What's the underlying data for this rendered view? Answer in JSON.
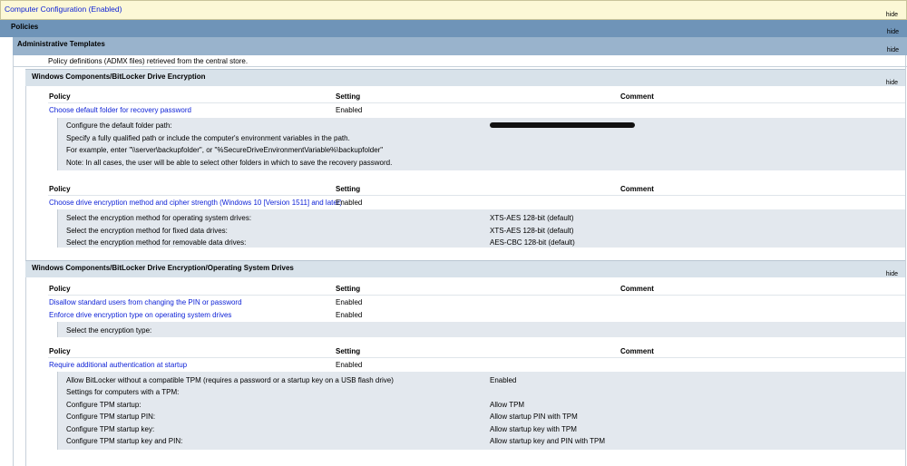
{
  "hide_label": "hide",
  "computer_config": {
    "title": "Computer Configuration (Enabled)"
  },
  "policies": {
    "title": "Policies"
  },
  "admin_templates": {
    "title": "Administrative Templates",
    "note": "Policy definitions (ADMX files) retrieved from the central store."
  },
  "table_headers": {
    "policy": "Policy",
    "setting": "Setting",
    "comment": "Comment"
  },
  "sections": [
    {
      "title": "Windows Components/BitLocker Drive Encryption",
      "groups": [
        {
          "policies": [
            {
              "name": "Choose default folder for recovery password",
              "setting": "Enabled"
            }
          ],
          "details": [
            {
              "label": "Configure the default folder path:",
              "value": ""
            },
            {
              "label": "Specify a fully qualified path or include the computer's environment variables in the path.",
              "value": ""
            },
            {
              "label": "For example, enter \"\\\\server\\backupfolder\", or \"%SecureDriveEnvironmentVariable%\\backupfolder\"",
              "value": ""
            },
            {
              "label": "Note: In all cases, the user will be able to select other folders in which to save the recovery password.",
              "value": ""
            }
          ]
        },
        {
          "policies": [
            {
              "name": "Choose drive encryption method and cipher strength (Windows 10 [Version 1511] and later)",
              "setting": "Enabled"
            }
          ],
          "details": [
            {
              "label": "Select the encryption method for operating system drives:",
              "value": "XTS-AES 128-bit (default)"
            },
            {
              "label": "Select the encryption method for fixed data drives:",
              "value": "XTS-AES 128-bit (default)"
            },
            {
              "label": "Select the encryption method for removable data drives:",
              "value": "AES-CBC 128-bit (default)"
            }
          ]
        }
      ]
    },
    {
      "title": "Windows Components/BitLocker Drive Encryption/Operating System Drives",
      "groups": [
        {
          "policies": [
            {
              "name": "Disallow standard users from changing the PIN or password",
              "setting": "Enabled"
            },
            {
              "name": "Enforce drive encryption type on operating system drives",
              "setting": "Enabled"
            }
          ],
          "details": [
            {
              "label": "Select the encryption type:",
              "value": ""
            }
          ]
        },
        {
          "policies": [
            {
              "name": "Require additional authentication at startup",
              "setting": "Enabled"
            }
          ],
          "details": [
            {
              "label": "Allow BitLocker without a compatible TPM (requires a password or a startup key on a USB flash drive)",
              "value": "Enabled"
            },
            {
              "label": "Settings for computers with a TPM:",
              "value": ""
            },
            {
              "label": "Configure TPM startup:",
              "value": "Allow TPM"
            },
            {
              "label": "Configure TPM startup PIN:",
              "value": "Allow startup PIN with TPM"
            },
            {
              "label": "Configure TPM startup key:",
              "value": "Allow startup key with TPM"
            },
            {
              "label": "Configure TPM startup key and PIN:",
              "value": "Allow startup key and PIN with TPM"
            }
          ]
        }
      ]
    }
  ]
}
